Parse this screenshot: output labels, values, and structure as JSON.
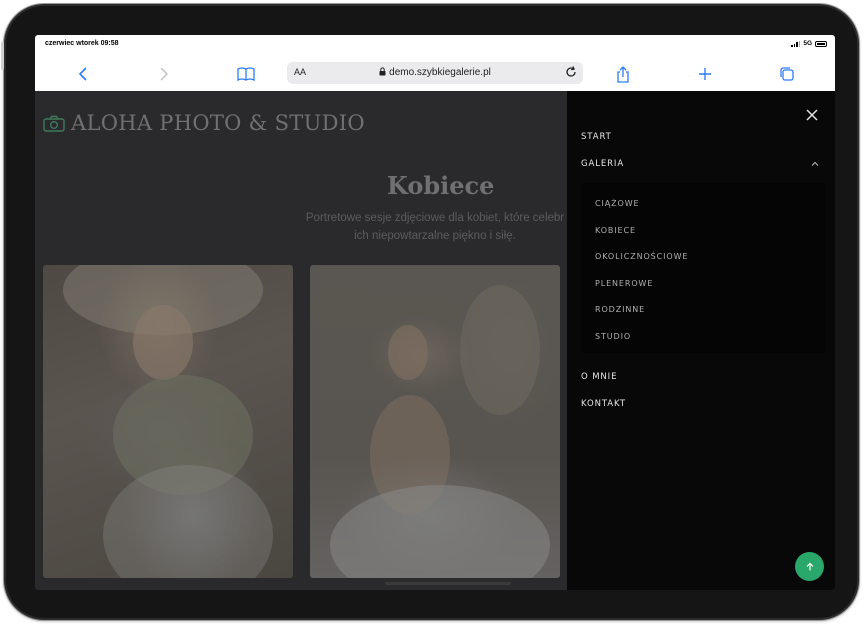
{
  "status": {
    "time": "czerwiec wtorek 09:58",
    "network": "5G"
  },
  "browser": {
    "text_size_label": "AA",
    "url": "demo.szybkiegalerie.pl"
  },
  "site": {
    "logo": "ALOHA PHOTO & STUDIO",
    "title": "Kobiece",
    "description_line1": "Portretowe sesje zdjęciowe dla kobiet, które celebr",
    "description_line2": "ich niepowtarzalne piękno i siłę."
  },
  "menu": {
    "start": "START",
    "galeria": "GALERIA",
    "submenu": [
      "CIĄŻOWE",
      "KOBIECE",
      "OKOLICZNOŚCIOWE",
      "PLENEROWE",
      "RODZINNE",
      "STUDIO"
    ],
    "o_mnie": "O MNIE",
    "kontakt": "KONTAKT"
  },
  "colors": {
    "accent_blue": "#2c7df6",
    "scroll_button_green": "#2aa76a",
    "menu_bg": "#080808"
  },
  "icons": [
    "back-icon",
    "forward-icon",
    "bookmarks-icon",
    "lock-icon",
    "reload-icon",
    "share-icon",
    "plus-icon",
    "tabs-icon",
    "camera-icon",
    "close-icon",
    "chevron-up-icon",
    "arrow-up-icon"
  ]
}
